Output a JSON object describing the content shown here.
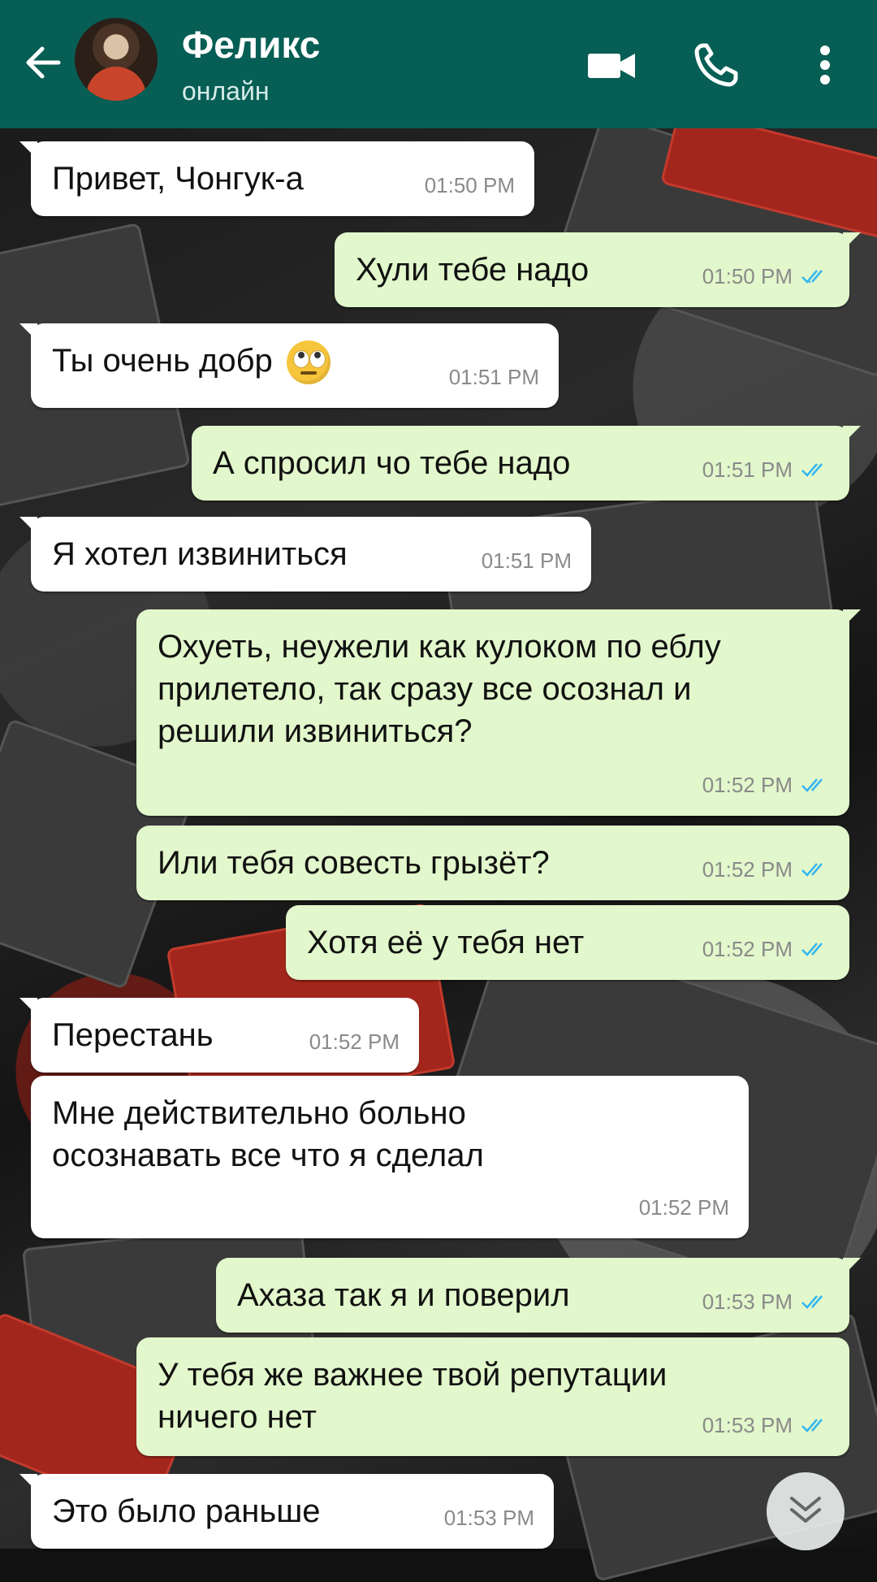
{
  "header": {
    "contact_name": "Феликс",
    "status": "онлайн",
    "icons": [
      "back-arrow-icon",
      "avatar",
      "video-call-icon",
      "phone-icon",
      "more-vert-icon"
    ]
  },
  "messages": [
    {
      "dir": "in",
      "text": "Привет, Чонгук-а",
      "time": "01:50 PM"
    },
    {
      "dir": "out",
      "text": "Хули тебе надо",
      "time": "01:50 PM",
      "read": true
    },
    {
      "dir": "in",
      "text": "Ты очень добр",
      "emoji": "face-with-rolling-eyes",
      "time": "01:51 PM"
    },
    {
      "dir": "out",
      "text": "А спросил чо тебе надо",
      "time": "01:51 PM",
      "read": true
    },
    {
      "dir": "in",
      "text": "Я хотел извиниться",
      "time": "01:51 PM"
    },
    {
      "dir": "out",
      "text": "Охуеть, неужели как кулоком по еблу прилетело, так сразу все осознал и решили извиниться?",
      "time": "01:52 PM",
      "read": true
    },
    {
      "dir": "out",
      "text": "Или тебя совесть грызёт?",
      "time": "01:52 PM",
      "read": true
    },
    {
      "dir": "out",
      "text": "Хотя её у тебя нет",
      "time": "01:52 PM",
      "read": true
    },
    {
      "dir": "in",
      "text": "Перестань",
      "time": "01:52 PM"
    },
    {
      "dir": "in",
      "text": "Мне действительно больно осознавать все что я сделал",
      "time": "01:52 PM"
    },
    {
      "dir": "out",
      "text": "Ахаза так я и поверил",
      "time": "01:53 PM",
      "read": true
    },
    {
      "dir": "out",
      "text": "У тебя же важнее твой репутации ничего нет",
      "time": "01:53 PM",
      "read": true
    },
    {
      "dir": "in",
      "text": "Это было раньше",
      "time": "01:53 PM"
    }
  ],
  "colors": {
    "header": "#075e54",
    "incoming_bubble": "#ffffff",
    "outgoing_bubble": "#e2f7cb",
    "read_ticks": "#34b7f1"
  },
  "scroll_down_icon": "double-chevron-down-icon"
}
